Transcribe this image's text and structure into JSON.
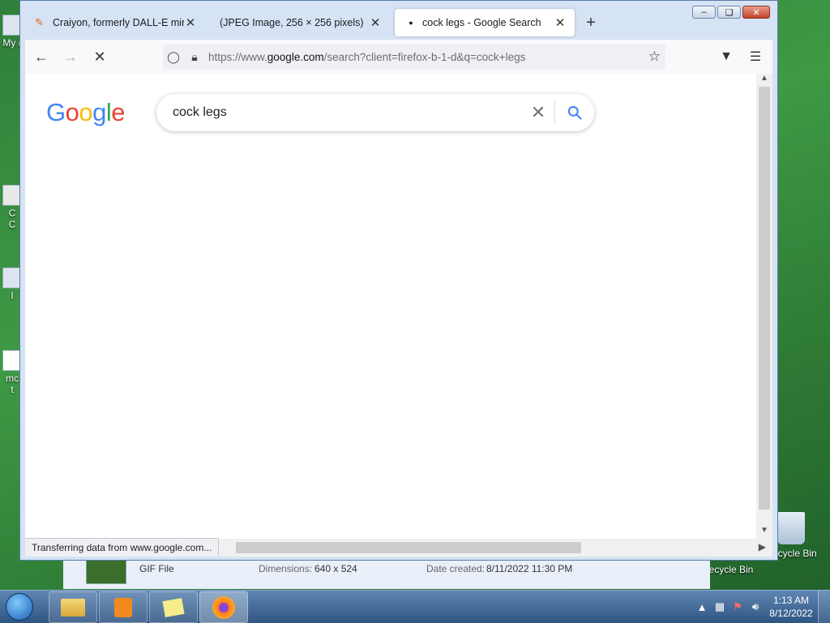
{
  "desktop": {
    "left_icons": [
      "My (",
      "C\nC",
      "I",
      "mc\nt"
    ],
    "right_icons": [
      "ecycle Bin",
      "Recycle Bin"
    ]
  },
  "explorer_details": {
    "file_type": "GIF File",
    "dimensions_label": "Dimensions:",
    "dimensions_value": "640 x 524",
    "date_label": "Date created:",
    "date_value": "8/11/2022 11:30 PM"
  },
  "browser": {
    "tabs": [
      {
        "title": "Craiyon, formerly DALL-E mini",
        "favicon": "pencil-icon",
        "active": false
      },
      {
        "title": "(JPEG Image, 256 × 256 pixels)",
        "favicon": "",
        "active": false
      },
      {
        "title": "cock legs - Google Search",
        "favicon": "loading-dot-icon",
        "active": true
      }
    ],
    "url_host_prefix": "https://www.",
    "url_host": "google.com",
    "url_path": "/search?client=firefox-b-1-d&q=cock+legs",
    "status_text": "Transferring data from www.google.com..."
  },
  "google": {
    "logo_letters": [
      "G",
      "o",
      "o",
      "g",
      "l",
      "e"
    ],
    "logo_colors": [
      "#4285F4",
      "#EA4335",
      "#FBBC05",
      "#4285F4",
      "#34A853",
      "#EA4335"
    ],
    "query": "cock legs"
  },
  "taskbar": {
    "time": "1:13 AM",
    "date": "8/12/2022"
  }
}
